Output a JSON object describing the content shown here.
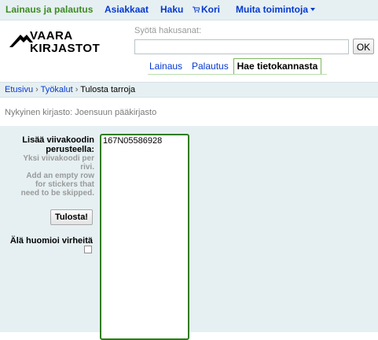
{
  "topnav": {
    "items": [
      "Lainaus ja palautus",
      "Asiakkaat",
      "Haku",
      "Kori",
      "Muita toimintoja"
    ]
  },
  "logo": {
    "line1": "VAARA",
    "line2": "KIRJASTOT"
  },
  "search": {
    "label": "Syötä hakusanat:",
    "value": "",
    "ok": "OK"
  },
  "tabs": [
    "Lainaus",
    "Palautus",
    "Hae tietokannasta"
  ],
  "breadcrumb": {
    "items": [
      "Etusivu",
      "Työkalut",
      "Tulosta tarroja"
    ],
    "sep": "›"
  },
  "library": "Nykyinen kirjasto: Joensuun pääkirjasto",
  "form": {
    "label_line1": "Lisää viivakoodin",
    "label_line2": "perusteella:",
    "hint_lines": [
      "Yksi viivakoodi per",
      "rivi.",
      "Add an empty row",
      "for stickers that",
      "need to be skipped."
    ],
    "print_button": "Tulosta!",
    "ignore_errors": "Älä huomioi virheitä",
    "ignore_errors_checked": false,
    "barcodes": "167N05586928"
  },
  "colors": {
    "nav_bg": "#e6f0f2",
    "link": "#0538d2",
    "first_link": "#3e8a23",
    "accent_green": "#2f7d1d"
  }
}
